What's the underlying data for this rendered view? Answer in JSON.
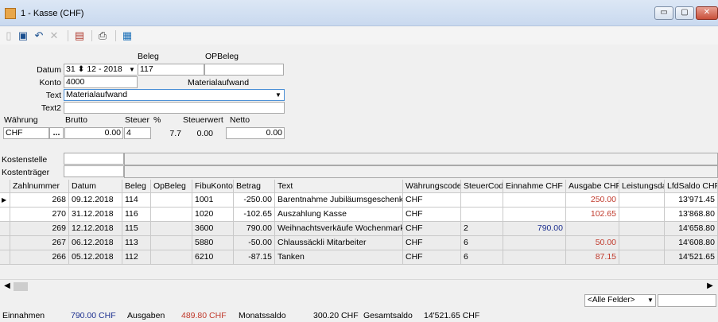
{
  "window": {
    "title": "1 - Kasse (CHF)",
    "minimize": "▭",
    "maximize": "▢",
    "close": "✕"
  },
  "toolbar": {
    "icons": [
      "new-icon",
      "save-icon",
      "undo-icon",
      "delete-icon",
      "pdf-icon",
      "print-icon",
      "calculator-icon"
    ]
  },
  "form": {
    "beleg_label": "Beleg",
    "opbeleg_label": "OPBeleg",
    "datum_label": "Datum",
    "datum_day": "31",
    "datum_month": "12 - 2018",
    "beleg_value": "117",
    "opbeleg_value": "",
    "konto_label": "Konto",
    "konto_value": "4000",
    "konto_name": "Materialaufwand",
    "text_label": "Text",
    "text_value": "Materialaufwand",
    "text2_label": "Text2",
    "text2_value": "",
    "waehrung_label": "Währung",
    "brutto_label": "Brutto",
    "steuer_label": "Steuer",
    "percent_label": "%",
    "steuerwert_label": "Steuerwert",
    "netto_label": "Netto",
    "waehrung_value": "CHF",
    "waehrung_btn": "...",
    "brutto_value": "0.00",
    "steuer_value": "4",
    "percent_value": "7.7",
    "steuerwert_value": "0.00",
    "netto_value": "0.00",
    "kostenstelle_label": "Kostenstelle",
    "kostentraeger_label": "Kostenträger"
  },
  "table": {
    "columns": [
      "Zahlnummer",
      "Datum",
      "Beleg",
      "OpBeleg",
      "FibuKonto",
      "Betrag",
      "Text",
      "Währungscode",
      "SteuerCode",
      "Einnahme CHF",
      "Ausgabe CHF",
      "Leistungsdatu",
      "LfdSaldo CHF"
    ],
    "rows": [
      {
        "nr": "268",
        "datum": "09.12.2018",
        "beleg": "114",
        "opbeleg": "",
        "konto": "1001",
        "betrag": "-250.00",
        "text": "Barentnahme Jubiläumsgeschenke",
        "wc": "CHF",
        "sc": "",
        "ein": "",
        "aus": "250.00",
        "ld": "",
        "saldo": "13'971.45"
      },
      {
        "nr": "270",
        "datum": "31.12.2018",
        "beleg": "116",
        "opbeleg": "",
        "konto": "1020",
        "betrag": "-102.65",
        "text": "Auszahlung Kasse",
        "wc": "CHF",
        "sc": "",
        "ein": "",
        "aus": "102.65",
        "ld": "",
        "saldo": "13'868.80"
      },
      {
        "nr": "269",
        "datum": "12.12.2018",
        "beleg": "115",
        "opbeleg": "",
        "konto": "3600",
        "betrag": "790.00",
        "text": "Weihnachtsverkäufe Wochenmarkt",
        "wc": "CHF",
        "sc": "2",
        "ein": "790.00",
        "aus": "",
        "ld": "",
        "saldo": "14'658.80"
      },
      {
        "nr": "267",
        "datum": "06.12.2018",
        "beleg": "113",
        "opbeleg": "",
        "konto": "5880",
        "betrag": "-50.00",
        "text": "Chlaussäckli Mitarbeiter",
        "wc": "CHF",
        "sc": "6",
        "ein": "",
        "aus": "50.00",
        "ld": "",
        "saldo": "14'608.80"
      },
      {
        "nr": "266",
        "datum": "05.12.2018",
        "beleg": "112",
        "opbeleg": "",
        "konto": "6210",
        "betrag": "-87.15",
        "text": "Tanken",
        "wc": "CHF",
        "sc": "6",
        "ein": "",
        "aus": "87.15",
        "ld": "",
        "saldo": "14'521.65"
      }
    ]
  },
  "filter": {
    "selected": "<Alle Felder>",
    "search_value": ""
  },
  "status": {
    "einnahmen_label": "Einnahmen",
    "einnahmen_value": "790.00 CHF",
    "ausgaben_label": "Ausgaben",
    "ausgaben_value": "489.80 CHF",
    "monatssaldo_label": "Monatssaldo",
    "monatssaldo_value": "300.20 CHF",
    "gesamtsaldo_label": "Gesamtsaldo",
    "gesamtsaldo_value": "14'521.65 CHF"
  },
  "colors": {
    "einnahmen": "#1c2f8f",
    "ausgaben": "#c0392b"
  }
}
